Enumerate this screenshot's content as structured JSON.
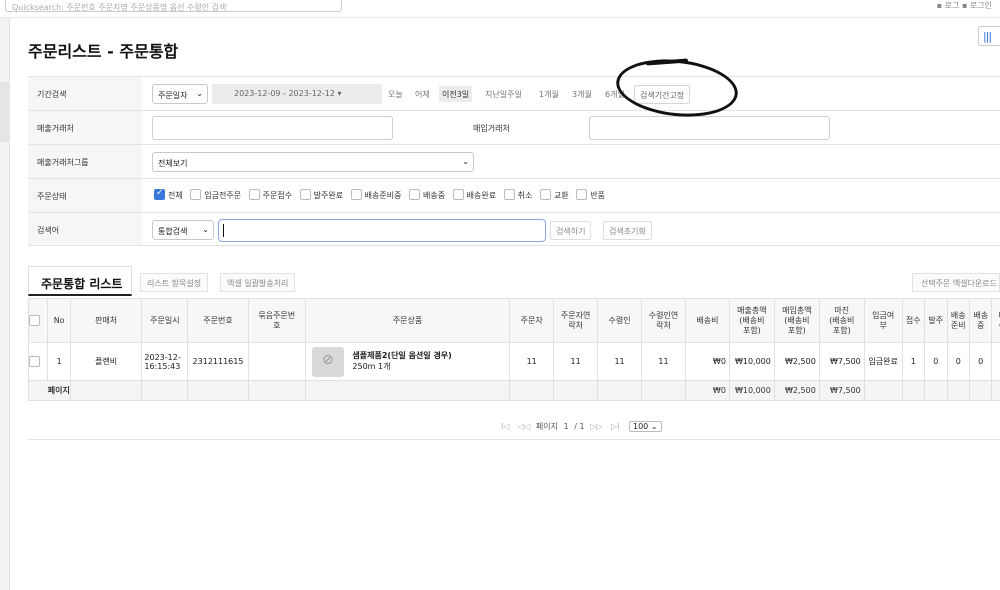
{
  "topbar": {
    "quick_search": "Quicksearch: 주문번호 주문자명 주문상품명 옵션 수령인 검색",
    "right_text": "▪ 로그 ▪ 로그인"
  },
  "page_title": "주문리스트 - 주문통합",
  "toolbar_icon": "|||",
  "filters": {
    "period": {
      "label": "기간검색",
      "type_value": "주문일자",
      "range": "2023-12-09 - 2023-12-12",
      "quick": [
        "오늘",
        "어제",
        "이전3일",
        "지난일주일",
        "1개월",
        "3개월",
        "6개월"
      ],
      "active_quick": "이전3일",
      "fix_button": "검색기간고정"
    },
    "sales_vendor": {
      "label": "매출거래처",
      "value": ""
    },
    "purchase_vendor": {
      "label": "매입거래처",
      "value": ""
    },
    "vendor_group": {
      "label": "매출거래처그룹",
      "value": "전체보기"
    },
    "status": {
      "label": "주문상태",
      "options": [
        "전체",
        "입금전주문",
        "주문접수",
        "발주완료",
        "배송준비중",
        "배송중",
        "배송완료",
        "취소",
        "교환",
        "반품"
      ],
      "checked": [
        "전체"
      ]
    },
    "keyword": {
      "label": "검색어",
      "type_value": "통합검색",
      "value": "",
      "search_button": "검색하기",
      "reset_button": "검색초기화"
    }
  },
  "tabs": {
    "main": "주문통합 리스트",
    "list_settings": "리스트 항목설정",
    "excel_bulk": "엑셀 일괄발송처리",
    "excel_download": "선택주문 엑셀다운로드"
  },
  "table": {
    "headers": [
      "",
      "No",
      "판매처",
      "주문일시",
      "주문번호",
      "묶음주문번호",
      "주문상품",
      "주문자",
      "주문자연락처",
      "수령인",
      "수령인연락처",
      "배송비",
      "매출총액(배송비포함)",
      "매입총액(배송비포함)",
      "마진(배송비포함)",
      "입금여부",
      "접수",
      "발주",
      "배송준비",
      "배송중",
      ""
    ],
    "header_display": [
      "",
      "No",
      "판매처",
      "주문일시",
      "주문번호",
      "묶음주문번\n호",
      "주문상품",
      "주문자",
      "주문자연\n락처",
      "수령인",
      "수령인연\n락처",
      "배송비",
      "매출총액\n(배송비\n포함)",
      "매입총액\n(배송비\n포함)",
      "마진\n(배송비\n포함)",
      "입금여\n부",
      "접수",
      "발주",
      "배송\n준비",
      "배송\n중",
      "미\n수"
    ],
    "rows": [
      {
        "no": "1",
        "seller": "플랜비",
        "order_datetime": "2023-12-\n16:15:43",
        "order_no": "2312111615",
        "bundle_no": "",
        "product_name": "샘플제품2(단일 옵션일 경우)",
        "product_option": "250m 1개",
        "orderer": "11",
        "orderer_contact": "11",
        "receiver": "11",
        "receiver_contact": "11",
        "shipping": "₩0",
        "sales_total": "₩10,000",
        "purchase_total": "₩2,500",
        "margin": "₩7,500",
        "payment": "입금완료",
        "received": "1",
        "ordered": "0",
        "preparing": "0",
        "shipping_cnt": "0"
      }
    ],
    "summary": {
      "label": "페이지",
      "shipping": "₩0",
      "sales_total": "₩10,000",
      "purchase_total": "₩2,500",
      "margin": "₩7,500"
    }
  },
  "pager": {
    "first": "I◁",
    "prev": "◁◁",
    "page_label": "페이지",
    "page": "1",
    "of": "/ 1",
    "next": "▷▷",
    "last": "▷I",
    "page_size": "100"
  }
}
